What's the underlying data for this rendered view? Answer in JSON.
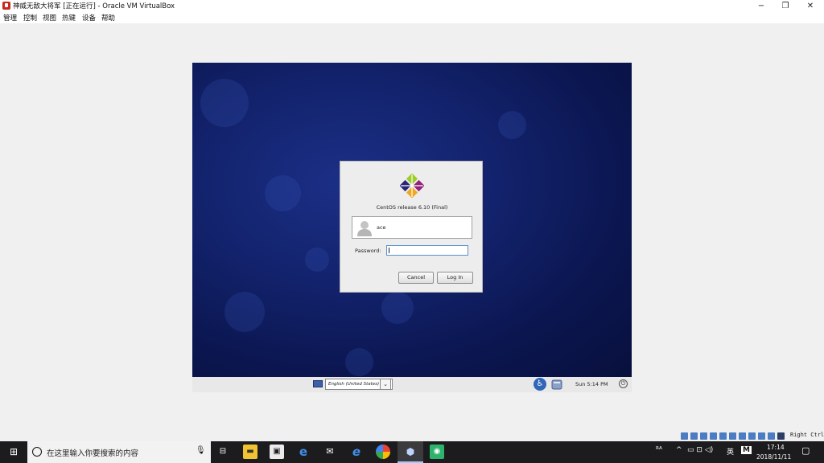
{
  "window": {
    "title": "神威无敌大将军 [正在运行] - Oracle VM VirtualBox",
    "controls": {
      "minimize": "−",
      "maximize": "❐",
      "close": "✕"
    }
  },
  "menu": {
    "items": [
      "管理",
      "控制",
      "视图",
      "热键",
      "设备",
      "帮助"
    ]
  },
  "login": {
    "release": "CentOS release 6.10 (Final)",
    "user": "ace",
    "password_label": "Password:",
    "password_value": "",
    "cancel_label": "Cancel",
    "login_label": "Log In"
  },
  "vm_panel": {
    "language": "English (United States)",
    "clock": "Sun  5:14 PM",
    "dropdown_glyph": "⌄",
    "power_glyph": "⏻",
    "accessibility_glyph": "♿"
  },
  "vbox_status": {
    "host_key": "Right Ctrl"
  },
  "taskbar": {
    "search_placeholder": "在这里输入你要搜索的内容",
    "start_glyph": "⊞",
    "mic_glyph": "🎙",
    "tray": {
      "person": "ᴿᴬ",
      "chevron": "^",
      "icons": "▭ ⊡ ◁)",
      "ime": "英",
      "ime_box": "M"
    },
    "time": "17:14",
    "date": "2018/11/11",
    "notification_glyph": "▢"
  }
}
